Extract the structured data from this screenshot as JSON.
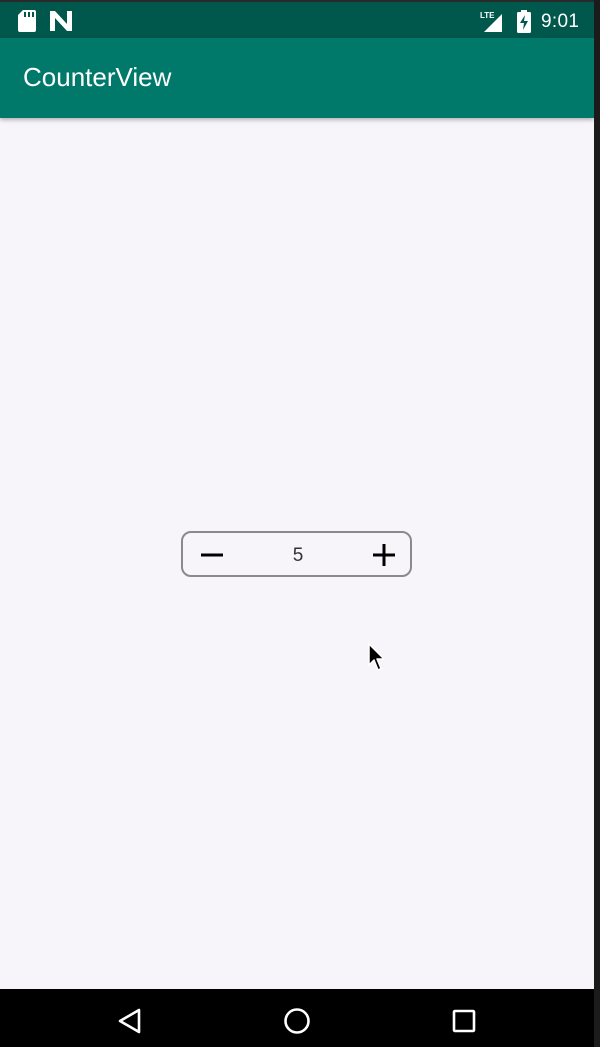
{
  "status_bar": {
    "time": "9:01",
    "network": "LTE",
    "background_color": "#00574b",
    "icons": [
      "sd-card-icon",
      "n-logo-icon",
      "lte-signal-icon",
      "battery-charging-icon"
    ]
  },
  "app_bar": {
    "title": "CounterView",
    "background_color": "#00796b"
  },
  "counter": {
    "value": "5",
    "decrement_icon": "minus-icon",
    "increment_icon": "plus-icon"
  },
  "nav_bar": {
    "icons": [
      "back-icon",
      "home-icon",
      "recents-icon"
    ]
  }
}
